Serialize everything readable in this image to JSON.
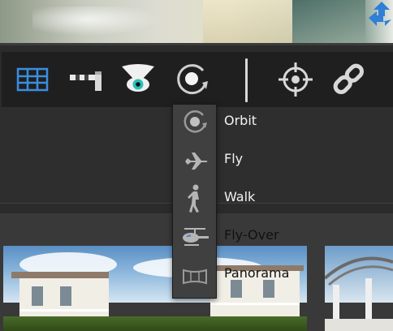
{
  "toolbar": {
    "buttons": [
      {
        "name": "grid-button",
        "icon": "grid-icon",
        "color": "#3a8ee0"
      },
      {
        "name": "gate-button",
        "icon": "barrier-gate-icon"
      },
      {
        "name": "view-button",
        "icon": "eye-view-cone-icon",
        "color": "#27c1b8"
      },
      {
        "name": "orbit-mode-button",
        "icon": "orbit-icon"
      },
      {
        "name": "target-button",
        "icon": "crosshair-icon"
      },
      {
        "name": "link-button",
        "icon": "chain-link-icon"
      }
    ]
  },
  "navigation_modes": {
    "items": [
      {
        "label": "Orbit",
        "icon": "orbit-icon"
      },
      {
        "label": "Fly",
        "icon": "airplane-icon"
      },
      {
        "label": "Walk",
        "icon": "walking-person-icon"
      },
      {
        "label": "Fly-Over",
        "icon": "helicopter-icon"
      },
      {
        "label": "Panorama",
        "icon": "panorama-icon"
      }
    ]
  },
  "colors": {
    "accent_blue": "#3a8ee0",
    "eye_teal": "#27c1b8",
    "icon_gray": "#cfcfcf"
  }
}
